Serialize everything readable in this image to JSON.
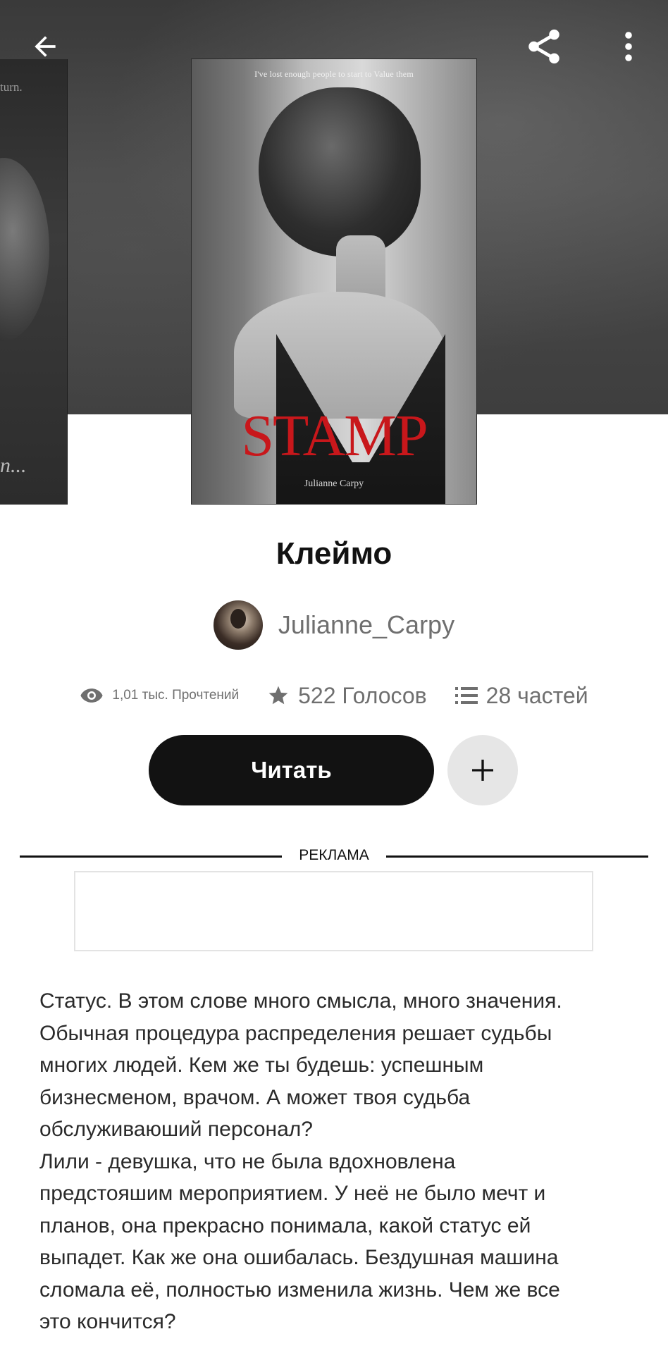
{
  "topbar": {
    "back_icon": "arrow-left-icon",
    "share_icon": "share-icon",
    "more_icon": "more-vertical-icon"
  },
  "covers": {
    "side_cover": {
      "snippet": "turn.",
      "ellipsis": "n..."
    },
    "main_cover": {
      "tagline": "I've lost enough people to start to Value them",
      "title_word": "STAMP",
      "author": "Julianne Carpy",
      "title_color": "#c8171b"
    }
  },
  "story": {
    "title": "Клеймо",
    "author_name": "Julianne_Carpy",
    "stats": {
      "reads": "1,01 тыс. Прочтений",
      "votes": "522 Голосов",
      "parts": "28 частей"
    }
  },
  "actions": {
    "read_label": "Читать",
    "add_icon": "plus-icon"
  },
  "ad": {
    "label": "РЕКЛАМА"
  },
  "description": "Статус. В этом слове много смысла, много значения.\nОбычная процедура распределения решает судьбы\nмногих людей. Кем же ты будешь: успешным\nбизнесменом, врачом. А может твоя судьба\nобслуживаюший персонал?\nЛили - девушка, что не была вдохновлена\nпредстояшим мероприятием. У неё не было мечт и\nпланов, она прекрасно понимала, какой статус ей\nвыпадет. Как же она ошибалась. Бездушная машина\nсломала её, полностью изменила жизнь. Чем же все\nэто кончится?",
  "colors": {
    "primary": "#121212",
    "muted_text": "#6f6f6f",
    "add_button_bg": "#e6e6e6"
  }
}
